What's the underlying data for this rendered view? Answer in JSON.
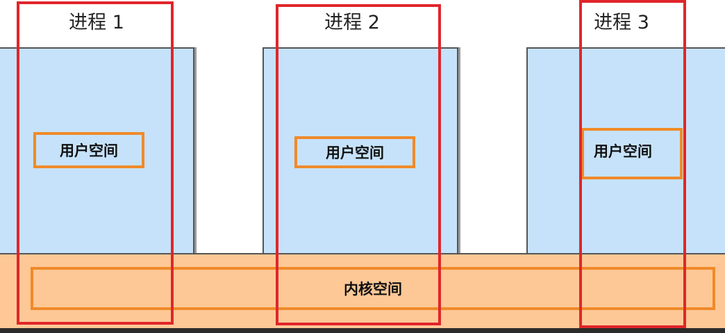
{
  "processes": [
    {
      "title": "进程 1",
      "user_space_label": "用户空间"
    },
    {
      "title": "进程 2",
      "user_space_label": "用户空间"
    },
    {
      "title": "进程 3",
      "user_space_label": "用户空间"
    }
  ],
  "kernel": {
    "label": "内核空间"
  },
  "colors": {
    "user_space_fill": "#c6e2fb",
    "kernel_space_fill": "#fdc896",
    "highlight_box": "#f08a2a",
    "process_frame": "#e0262b"
  }
}
